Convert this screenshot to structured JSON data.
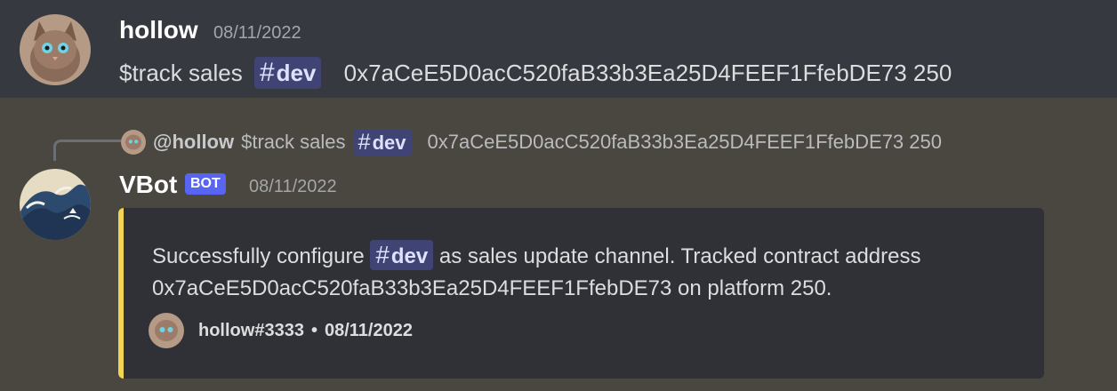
{
  "message1": {
    "author": "hollow",
    "timestamp": "08/11/2022",
    "command": "$track sales",
    "channel": "dev",
    "args": "0x7aCeE5D0acC520faB33b3Ea25D4FEEF1FfebDE73 250"
  },
  "reply": {
    "author": "@hollow",
    "command": "$track sales",
    "channel": "dev",
    "args": "0x7aCeE5D0acC520faB33b3Ea25D4FEEF1FfebDE73 250"
  },
  "message2": {
    "author": "VBot",
    "badge": "BOT",
    "timestamp": "08/11/2022",
    "embed": {
      "accent_color": "#f1d44f",
      "desc_before": "Successfully configure",
      "channel": "dev",
      "desc_after": "as sales update channel. Tracked contract address",
      "desc_line2": "0x7aCeE5D0acC520faB33b3Ea25D4FEEF1FfebDE73 on platform 250.",
      "footer_name": "hollow#3333",
      "footer_sep": "•",
      "footer_time": "08/11/2022"
    }
  },
  "icons": {
    "user_avatar": "cat-avatar-icon",
    "bot_avatar": "wave-avatar-icon",
    "channel_icon": "hash-icon"
  }
}
